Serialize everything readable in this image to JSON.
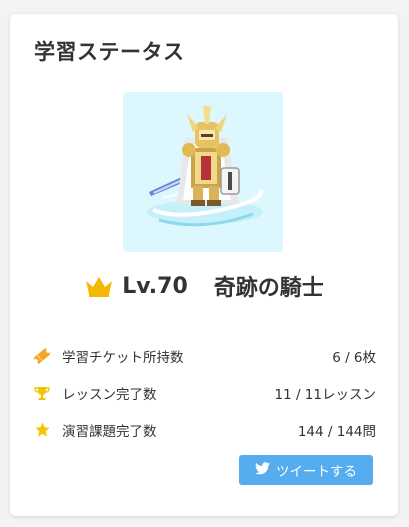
{
  "card": {
    "title": "学習ステータス"
  },
  "avatar": {
    "icon": "knight-character-sprite",
    "background_color": "#dcf7fd"
  },
  "level": {
    "icon": "crown-icon",
    "crown_color": "#f5b700",
    "label": "Lv.70",
    "class_name": "奇跡の騎士"
  },
  "stats": [
    {
      "icon": "ticket-icon",
      "icon_color": "#f5a623",
      "label": "学習チケット所持数",
      "value": "6 / 6枚"
    },
    {
      "icon": "trophy-icon",
      "icon_color": "#f5c400",
      "label": "レッスン完了数",
      "value": "11 / 11レッスン"
    },
    {
      "icon": "star-icon",
      "icon_color": "#f5c400",
      "label": "演習課題完了数",
      "value": "144 / 144問"
    }
  ],
  "tweet_button": {
    "icon": "twitter-bird-icon",
    "label": "ツイートする",
    "color": "#55acee"
  }
}
